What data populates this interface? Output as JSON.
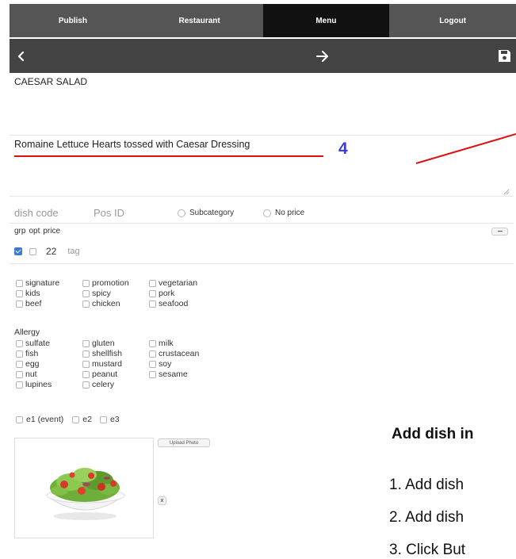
{
  "nav": {
    "tabs": [
      {
        "label": "Publish"
      },
      {
        "label": "Restaurant"
      },
      {
        "label": "Menu"
      },
      {
        "label": "Logout"
      }
    ],
    "active_index": 2
  },
  "toolbar": {
    "back_icon": "chevron-left-icon",
    "forward_icon": "arrow-right-icon",
    "save_icon": "floppy-disk-icon"
  },
  "dish": {
    "name": "CAESAR SALAD",
    "description": "Romaine Lettuce Hearts tossed with Caesar Dressing",
    "dish_code_placeholder": "dish code",
    "pos_id_placeholder": "Pos ID",
    "subcategory_label": "Subcategory",
    "no_price_label": "No price"
  },
  "annotation": {
    "number": "4",
    "color": "#dd1111",
    "number_color": "#3b3bd8"
  },
  "price_table": {
    "headers": [
      "grp",
      "opt",
      "price"
    ],
    "row": {
      "grp_checked": true,
      "opt_checked": false,
      "price": "22",
      "tag_placeholder": "tag"
    }
  },
  "tags": [
    "signature",
    "promotion",
    "vegetarian",
    "kids",
    "spicy",
    "pork",
    "beef",
    "chicken",
    "seafood"
  ],
  "allergy": {
    "title": "Allergy",
    "items": [
      "sulfate",
      "gluten",
      "milk",
      "fish",
      "shellfish",
      "crustacean",
      "egg",
      "mustard",
      "soy",
      "nut",
      "peanut",
      "sesame",
      "lupines",
      "celery"
    ]
  },
  "events": [
    "e1 (event)",
    "e2",
    "e3"
  ],
  "photo": {
    "upload_label": "Upload Photo",
    "remove_label": "x"
  },
  "side_text": {
    "heading": "Add dish in",
    "steps": [
      "1. Add dish",
      "2. Add dish",
      "3. Click But"
    ]
  }
}
